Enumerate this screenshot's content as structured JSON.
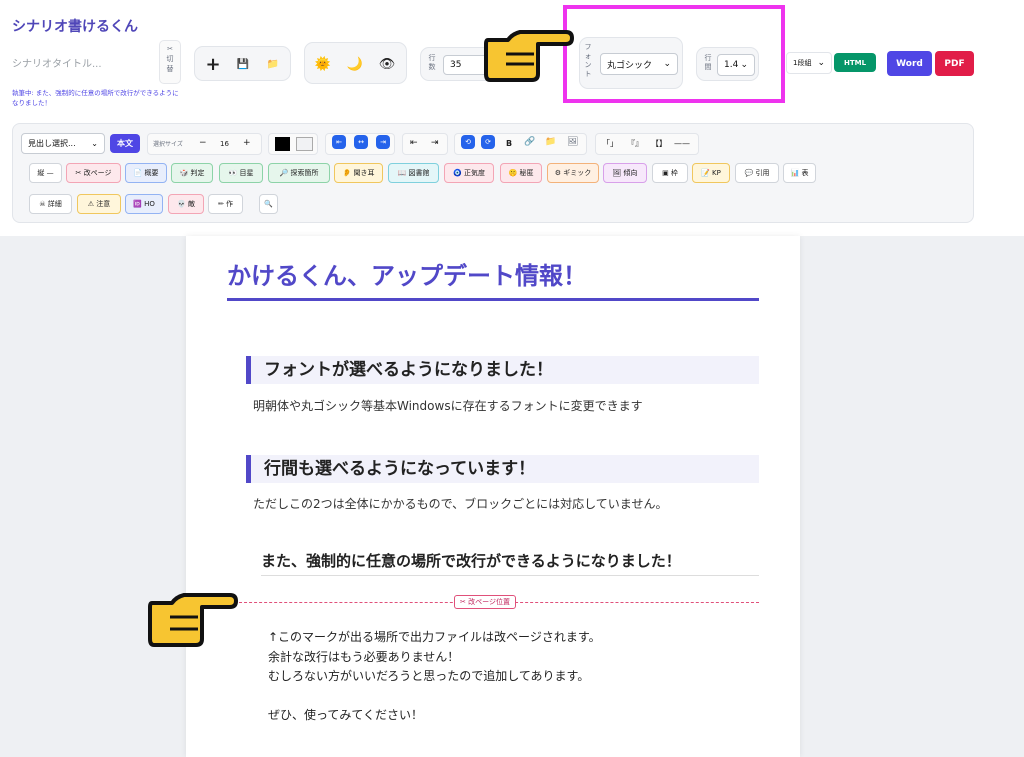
{
  "app": {
    "title": "シナリオ書けるくん",
    "scenario_title_placeholder": "シナリオタイトル...",
    "status": "執筆中: また、強制的に任意の場所で改行ができるようになりました！"
  },
  "toggle": {
    "icon": "✂",
    "label_top": "切",
    "label_bottom": "替"
  },
  "file": {
    "new_icon": "+",
    "save_icon": "💾",
    "open_icon": "📁"
  },
  "view": {
    "light_icon": "🌞",
    "dark_icon": "🌙",
    "preview_icon": "👁"
  },
  "lines": {
    "label_top": "行",
    "label_bottom": "数",
    "value": "35"
  },
  "font": {
    "label": "フォント",
    "value": "丸ゴシック"
  },
  "spacing": {
    "label_top": "行",
    "label_bottom": "間",
    "value": "1.4"
  },
  "columns": {
    "value": "1段組"
  },
  "export": {
    "html": "HTML",
    "word": "Word",
    "pdf": "PDF"
  },
  "colors": {
    "accent": "#5148c8",
    "html": "#059669",
    "word": "#4f46e5",
    "pdf": "#e11d48",
    "highlight": "#ee33ee",
    "pagebreak": "#e0507a"
  },
  "toolbar": {
    "heading_select": "見出し選択...",
    "body_button": "本文",
    "size_label": "選択サイズ",
    "size_minus": "−",
    "size_value": "16",
    "size_plus": "+",
    "align": [
      "⇤",
      "↔",
      "⇥"
    ],
    "indent": [
      "⇤",
      "⇥"
    ],
    "misc": [
      "⟲",
      "⟳",
      "B",
      "🔗",
      "📁",
      "🖼"
    ],
    "brackets": [
      "「」",
      "『』",
      "【】",
      "——"
    ],
    "row2": [
      "縦 —",
      "✂ 改ページ",
      "📄 概要",
      "🎲 判定",
      "👀 目星",
      "🔎 探索箇所",
      "👂 聞き耳",
      "📖 図書館",
      "🧿 正気度",
      "🤫 秘匿",
      "⚙ ギミック",
      "🖼 傾向",
      "▣ 枠",
      "📝 KP",
      "💬 引用",
      "📊 表"
    ],
    "row3": [
      "☠ 詳細",
      "⚠ 注意",
      "🆔 HO",
      "💀 敵",
      "✏ 作"
    ],
    "search_icon": "🔍"
  },
  "document": {
    "title": "かけるくん、アップデート情報！",
    "s1_heading": "フォントが選べるようになりました！",
    "s1_text": "明朝体や丸ゴシック等基本Windowsに存在するフォントに変更できます",
    "s2_heading": "行間も選べるようになっています！",
    "s2_text": "ただしこの2つは全体にかかるもので、ブロックごとには対応していません。",
    "s3_heading": "また、強制的に任意の場所で改行ができるようになりました！",
    "pagebreak_label": "✂ 改ページ位置",
    "body_lines": [
      "↑このマークが出る場所で出力ファイルは改ページされます。",
      "余計な改行はもう必要ありません！",
      "むしろない方がいいだろうと思ったので追加してあります。",
      "",
      "ぜひ、使ってみてください！"
    ]
  }
}
